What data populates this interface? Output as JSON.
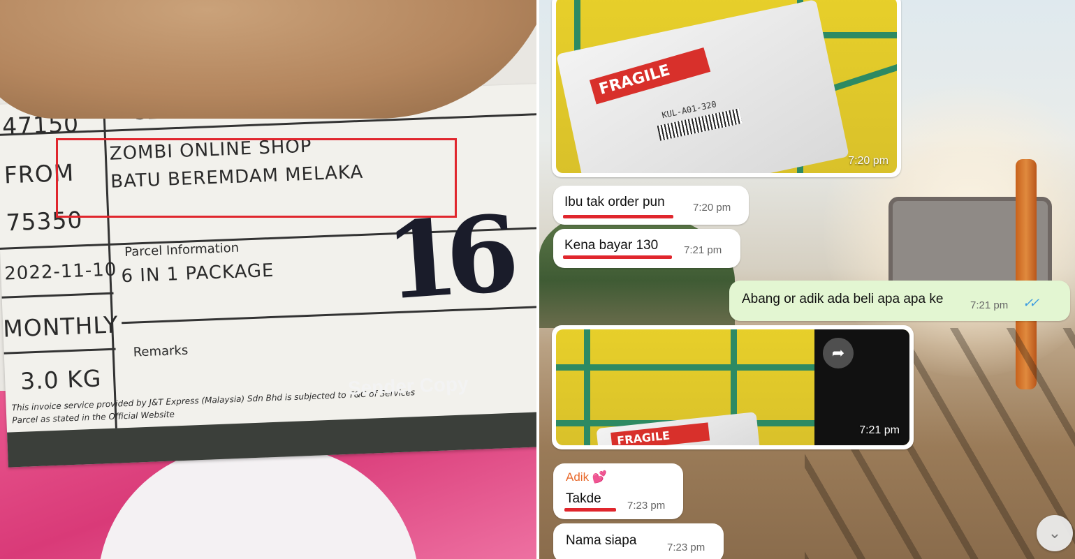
{
  "parcel_label": {
    "postcode_top": "47150",
    "top_cut_text": "SELANGOR",
    "from_label": "FROM",
    "sender_name": "ZOMBI ONLINE SHOP",
    "sender_address": "BATU BEREMDAM MELAKA",
    "postcode_bottom": "75350",
    "date": "2022-11-10",
    "parcel_info_label": "Parcel Information",
    "parcel_info_value": "6 IN 1 PACKAGE",
    "payment_type": "MONTHLY",
    "remarks_label": "Remarks",
    "weight": "3.0 KG",
    "disclaimer_line1": "This invoice service provided by J&T Express (Malaysia) Sdn Bhd is subjected to T&C of Services",
    "disclaimer_line2": "Parcel as stated in the Official Website",
    "copy_label": "Sender Copy",
    "handwritten_number": "16",
    "fragile_text": "FRAGILE",
    "sorting_code": "KUL-A01-320"
  },
  "chat": {
    "media_1": {
      "time": "7:20 pm"
    },
    "messages": [
      {
        "text": "Ibu tak order pun",
        "time": "7:20 pm",
        "direction": "in"
      },
      {
        "text": "Kena bayar 130",
        "time": "7:21 pm",
        "direction": "in"
      },
      {
        "text": "Abang or adik ada beli apa apa ke",
        "time": "7:21 pm",
        "direction": "out",
        "status": "read"
      }
    ],
    "media_2": {
      "time": "7:21 pm"
    },
    "reply_1": {
      "sender": "Adik 💕",
      "text": "Takde",
      "time": "7:23 pm"
    },
    "reply_2": {
      "text": "Nama siapa",
      "time": "7:23 pm"
    },
    "icons": {
      "forward": "forward-icon",
      "scroll_down": "chevron-double-down-icon",
      "read_receipt": "double-check-icon"
    },
    "colors": {
      "incoming_bubble": "#ffffff",
      "outgoing_bubble": "#e3f6d2",
      "underline_highlight": "#e0262d",
      "sender_name": "#e8692b",
      "read_tick": "#3c9be0"
    }
  }
}
